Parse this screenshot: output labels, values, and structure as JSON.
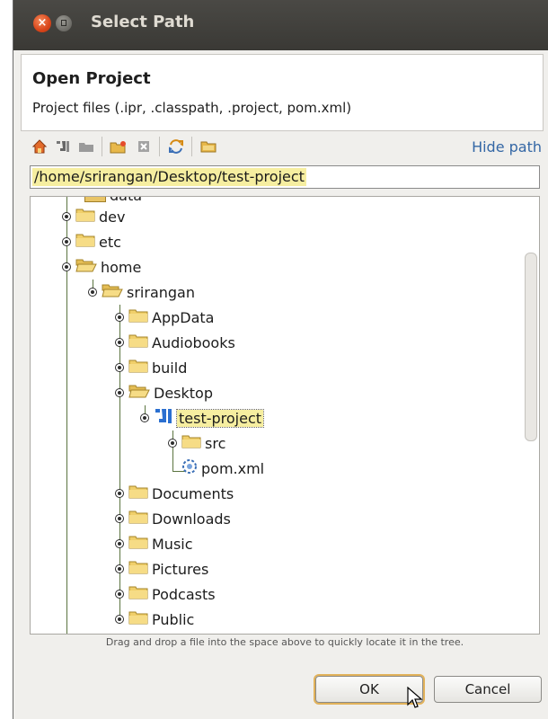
{
  "window": {
    "title": "Select Path"
  },
  "header": {
    "title": "Open Project",
    "subtitle": "Project files (.ipr, .classpath, .project, pom.xml)"
  },
  "toolbar": {
    "icons": [
      "home-icon",
      "intellij-project-icon",
      "folder-nav-icon",
      "new-folder-icon",
      "delete-icon",
      "refresh-icon",
      "show-hidden-icon"
    ],
    "hide_path_label": "Hide path"
  },
  "path": {
    "value": "/home/srirangan/Desktop/test-project"
  },
  "tree": {
    "partial_top": "data",
    "nodes": [
      {
        "label": "dev"
      },
      {
        "label": "etc"
      },
      {
        "label": "home"
      },
      {
        "label": "srirangan"
      },
      {
        "label": "AppData"
      },
      {
        "label": "Audiobooks"
      },
      {
        "label": "build"
      },
      {
        "label": "Desktop"
      },
      {
        "label": "test-project"
      },
      {
        "label": "src"
      },
      {
        "label": "pom.xml"
      },
      {
        "label": "Documents"
      },
      {
        "label": "Downloads"
      },
      {
        "label": "Music"
      },
      {
        "label": "Pictures"
      },
      {
        "label": "Podcasts"
      },
      {
        "label": "Public"
      }
    ]
  },
  "hint": "Drag and drop a file into the space above to quickly locate it in the tree.",
  "buttons": {
    "ok": "OK",
    "cancel": "Cancel"
  },
  "colors": {
    "titlebar": "#3d3c38",
    "close": "#d9451a",
    "selection": "#f6eea0",
    "link": "#3467a5"
  }
}
